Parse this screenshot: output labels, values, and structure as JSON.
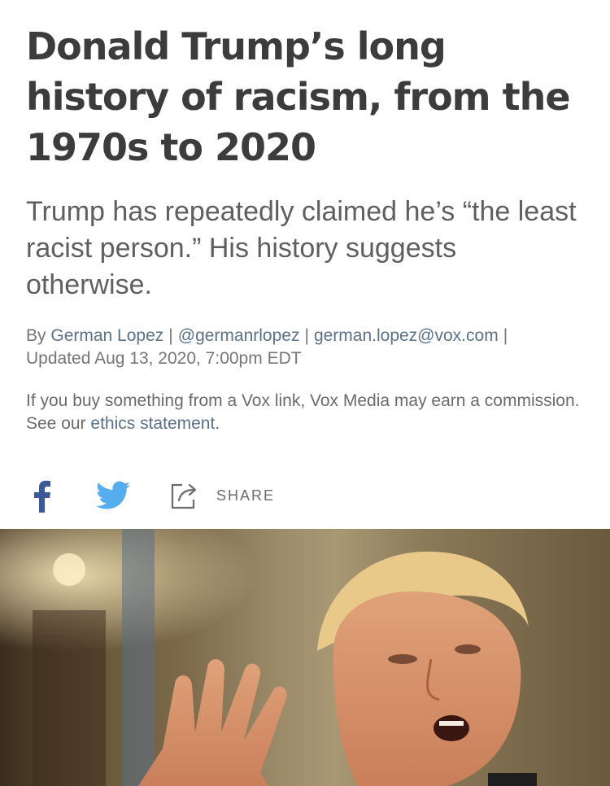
{
  "article": {
    "headline": "Donald Trump’s long history of racism, from the 1970s to 2020",
    "dek": "Trump has repeatedly claimed he’s “the least racist person.” His history suggests otherwise.",
    "byline": {
      "prefix": "By",
      "author": "German Lopez",
      "handle": "@germanrlopez",
      "email": "german.lopez@vox.com",
      "updated": "Updated Aug 13, 2020, 7:00pm EDT"
    },
    "disclosure": {
      "text": "If you buy something from a Vox link, Vox Media may earn a commission. See our",
      "link": "ethics statement",
      "end": "."
    }
  },
  "share": {
    "facebook_icon": "facebook-icon",
    "twitter_icon": "twitter-icon",
    "share_icon": "share-icon",
    "label": "SHARE"
  },
  "colors": {
    "headline": "#3c3c3c",
    "link": "#5a7288",
    "facebook": "#3b5998",
    "twitter": "#55acee"
  }
}
